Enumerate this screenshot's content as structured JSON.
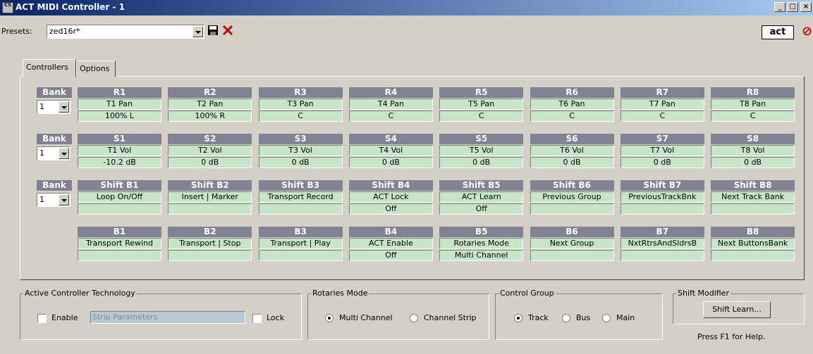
{
  "window": {
    "title": "ACT MIDI Controller - 1",
    "icon_text": "CS",
    "min": "_",
    "max": "□",
    "close": "×"
  },
  "presets": {
    "label": "Presets:",
    "value": "zed16r*"
  },
  "toolbar": {
    "save_icon": "save-icon",
    "delete_icon": "delete-icon",
    "act_logo": "act",
    "cancel_icon": "⊘"
  },
  "tabs": [
    "Controllers",
    "Options"
  ],
  "rows": [
    {
      "bank_label": "Bank",
      "bank_value": "1",
      "cells": [
        {
          "name": "R1",
          "param": "T1 Pan",
          "value": "100% L"
        },
        {
          "name": "R2",
          "param": "T2 Pan",
          "value": "100% R"
        },
        {
          "name": "R3",
          "param": "T3 Pan",
          "value": "C"
        },
        {
          "name": "R4",
          "param": "T4 Pan",
          "value": "C"
        },
        {
          "name": "R5",
          "param": "T5 Pan",
          "value": "C"
        },
        {
          "name": "R6",
          "param": "T6 Pan",
          "value": "C"
        },
        {
          "name": "R7",
          "param": "T7 Pan",
          "value": "C"
        },
        {
          "name": "R8",
          "param": "T8 Pan",
          "value": "C"
        }
      ]
    },
    {
      "bank_label": "Bank",
      "bank_value": "1",
      "cells": [
        {
          "name": "S1",
          "param": "T1 Vol",
          "value": "-10.2 dB"
        },
        {
          "name": "S2",
          "param": "T2 Vol",
          "value": "0 dB"
        },
        {
          "name": "S3",
          "param": "T3 Vol",
          "value": "0 dB"
        },
        {
          "name": "S4",
          "param": "T4 Vol",
          "value": "0 dB"
        },
        {
          "name": "S5",
          "param": "T5 Vol",
          "value": "0 dB"
        },
        {
          "name": "S6",
          "param": "T6 Vol",
          "value": "0 dB"
        },
        {
          "name": "S7",
          "param": "T7 Vol",
          "value": "0 dB"
        },
        {
          "name": "S8",
          "param": "T8 Vol",
          "value": "0 dB"
        }
      ]
    },
    {
      "bank_label": "Bank",
      "bank_value": "1",
      "cells": [
        {
          "name": "Shift B1",
          "param": "Loop On/Off",
          "value": ""
        },
        {
          "name": "Shift B2",
          "param": "Insert | Marker",
          "value": ""
        },
        {
          "name": "Shift B3",
          "param": "Transport Record",
          "value": ""
        },
        {
          "name": "Shift B4",
          "param": "ACT Lock",
          "value": "Off"
        },
        {
          "name": "Shift B5",
          "param": "ACT Learn",
          "value": "Off"
        },
        {
          "name": "Shift B6",
          "param": "Previous Group",
          "value": ""
        },
        {
          "name": "Shift B7",
          "param": "PreviousTrackBnk",
          "value": ""
        },
        {
          "name": "Shift B8",
          "param": "Next Track Bank",
          "value": ""
        }
      ]
    },
    {
      "bank_label": "",
      "bank_value": "",
      "cells": [
        {
          "name": "B1",
          "param": "Transport Rewind",
          "value": ""
        },
        {
          "name": "B2",
          "param": "Transport | Stop",
          "value": ""
        },
        {
          "name": "B3",
          "param": "Transport | Play",
          "value": ""
        },
        {
          "name": "B4",
          "param": "ACT Enable",
          "value": "Off"
        },
        {
          "name": "B5",
          "param": "Rotaries Mode",
          "value": "Multi Channel"
        },
        {
          "name": "B6",
          "param": "Next Group",
          "value": ""
        },
        {
          "name": "B7",
          "param": "NxtRtrsAndSldrsB",
          "value": ""
        },
        {
          "name": "B8",
          "param": "Next ButtonsBank",
          "value": ""
        }
      ]
    }
  ],
  "act_group": {
    "title": "Active Controller Technology",
    "enable": "Enable",
    "strip_placeholder": "Strip Parameters",
    "lock": "Lock"
  },
  "rotaries_group": {
    "title": "Rotaries Mode",
    "multi": "Multi Channel",
    "strip": "Channel Strip"
  },
  "control_group": {
    "title": "Control Group",
    "track": "Track",
    "bus": "Bus",
    "main": "Main"
  },
  "shift_group": {
    "title": "Shift Modifier",
    "button": "Shift Learn..."
  },
  "help": "Press F1 for Help."
}
